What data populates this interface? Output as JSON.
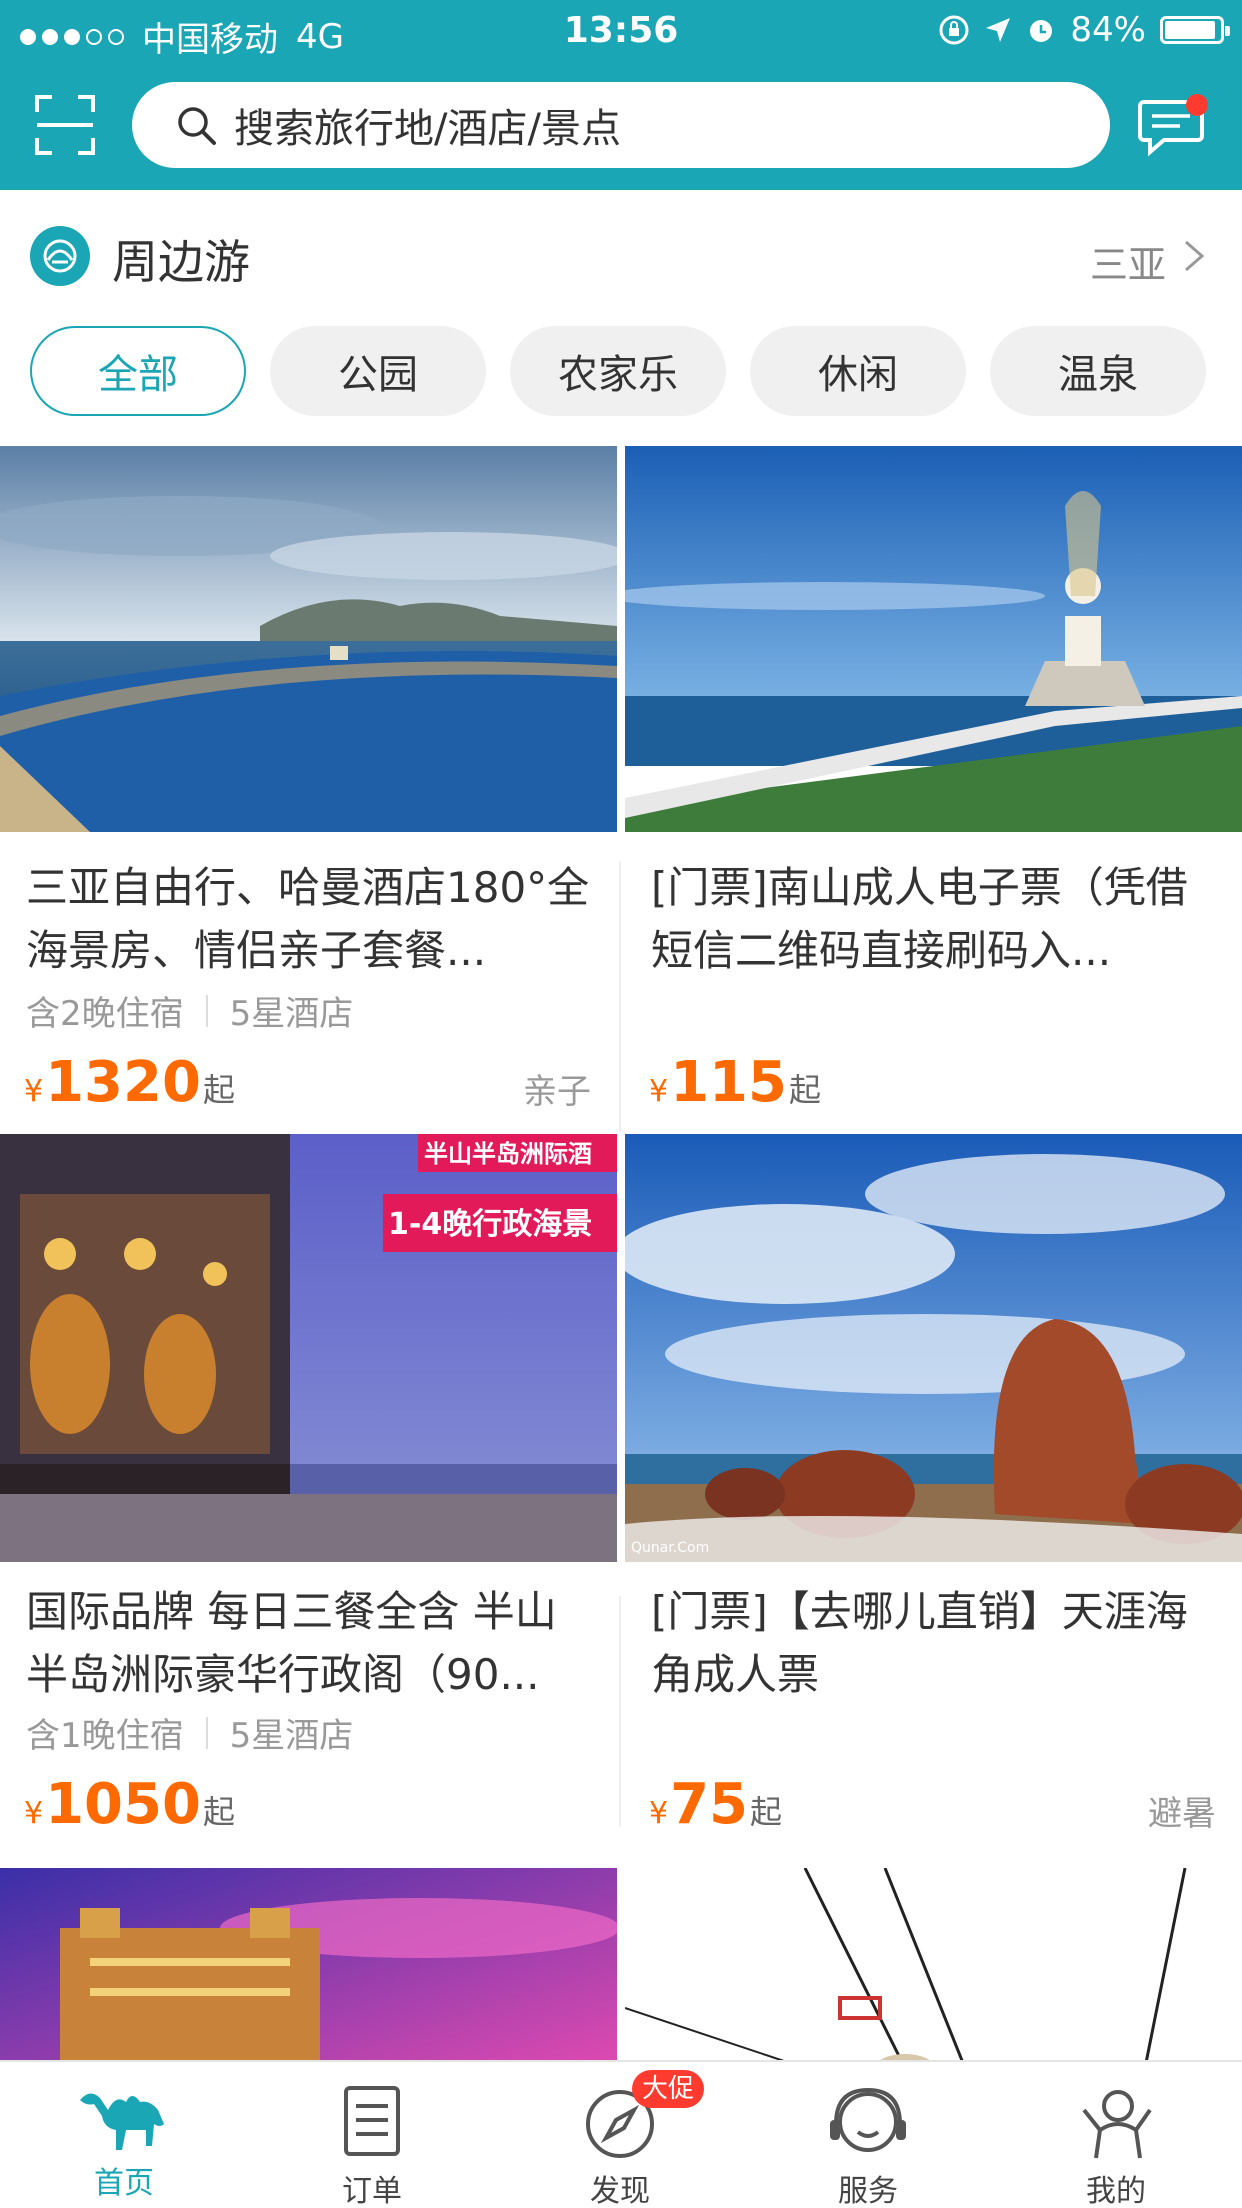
{
  "status_bar": {
    "carrier": "中国移动",
    "network": "4G",
    "time": "13:56",
    "battery": "84%"
  },
  "header": {
    "search_placeholder": "搜索旅行地/酒店/景点",
    "scan_icon": "scan-icon",
    "message_icon": "message-icon",
    "theme_color": "#1aa6b4"
  },
  "nearby": {
    "title": "周边游",
    "city": "三亚",
    "chips": [
      "全部",
      "公园",
      "农家乐",
      "休闲",
      "温泉"
    ],
    "active_chip": "全部"
  },
  "cards": [
    {
      "title": "三亚自由行、哈曼酒店180°全海景房、情侣亲子套餐...",
      "meta1": "含2晚住宿",
      "meta2": "5星酒店",
      "currency": "¥",
      "price": "1320",
      "suffix": "起",
      "tag": "亲子"
    },
    {
      "title": "[门票]南山成人电子票（凭借短信二维码直接刷码入...",
      "meta1": "",
      "meta2": "",
      "currency": "¥",
      "price": "115",
      "suffix": "起",
      "tag": ""
    },
    {
      "title": "国际品牌 每日三餐全含 半山半岛洲际豪华行政阁（90...",
      "meta1": "含1晚住宿",
      "meta2": "5星酒店",
      "currency": "¥",
      "price": "1050",
      "suffix": "起",
      "tag": "",
      "banner1": "半山半岛洲际酒",
      "banner2": "1-4晚行政海景"
    },
    {
      "title": "[门票]【去哪儿直销】天涯海角成人票",
      "meta1": "",
      "meta2": "",
      "currency": "¥",
      "price": "75",
      "suffix": "起",
      "tag": "避暑",
      "watermark": "Qunar.Com"
    }
  ],
  "tabbar": {
    "items": [
      {
        "label": "首页",
        "icon": "camel-icon",
        "active": true
      },
      {
        "label": "订单",
        "icon": "order-list-icon",
        "active": false
      },
      {
        "label": "发现",
        "icon": "compass-icon",
        "active": false,
        "badge": "大促"
      },
      {
        "label": "服务",
        "icon": "headset-icon",
        "active": false
      },
      {
        "label": "我的",
        "icon": "profile-icon",
        "active": false
      }
    ]
  }
}
